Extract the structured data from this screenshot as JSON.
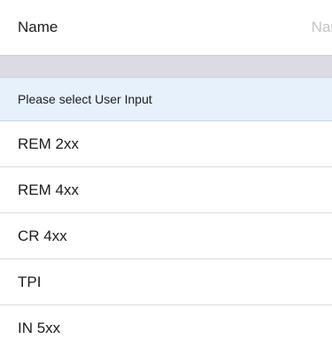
{
  "form": {
    "name_label": "Name",
    "name_value": "",
    "name_placeholder": "Name"
  },
  "picker": {
    "header": "Please select User Input",
    "options": [
      {
        "label": "REM 2xx"
      },
      {
        "label": "REM 4xx"
      },
      {
        "label": "CR 4xx"
      },
      {
        "label": "TPI"
      },
      {
        "label": "IN 5xx"
      }
    ]
  },
  "colors": {
    "header_background": "#e6f1fb",
    "separator_band": "#dcdae2",
    "placeholder_text": "#c4c4c9"
  }
}
